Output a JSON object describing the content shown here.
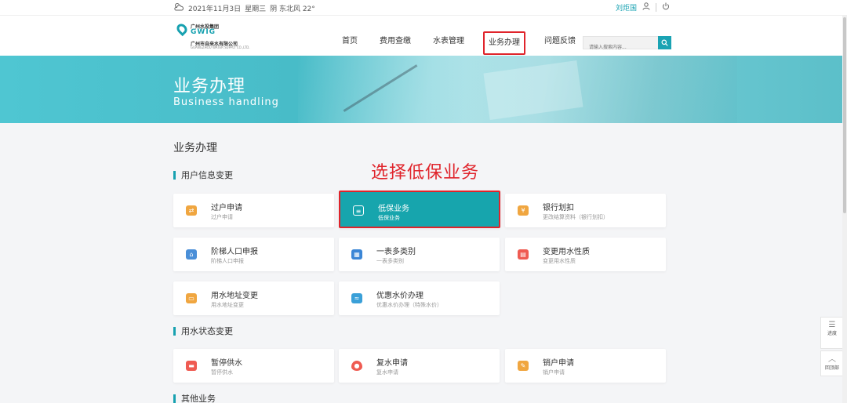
{
  "topbar": {
    "weather_icon": "cloud-sun-icon",
    "date": "2021年11月3日",
    "weekday": "星期三",
    "weather": "阴 东北风 22°",
    "username": "刘炬国",
    "user_icon": "user-icon",
    "power_icon": "power-icon"
  },
  "logo": {
    "line1": "广州水投集团",
    "line2": "GWIG",
    "line3": "广州市自来水有限公司",
    "line4": "GUANGZHOU WATER SUPPLY CO.,LTD."
  },
  "nav": {
    "items": [
      {
        "label": "首页"
      },
      {
        "label": "费用查缴"
      },
      {
        "label": "水表管理"
      },
      {
        "label": "业务办理"
      },
      {
        "label": "问题反馈"
      }
    ],
    "active_index": 3
  },
  "search": {
    "placeholder": "请输入搜索内容...",
    "button_icon": "search-icon"
  },
  "banner": {
    "title": "业务办理",
    "subtitle": "Business handling"
  },
  "main": {
    "title": "业务办理",
    "annotation": "选择低保业务",
    "sections": [
      {
        "title": "用户信息变更",
        "cards": [
          {
            "title": "过户申请",
            "sub": "过户申请",
            "icon": "transfer-icon",
            "color": "#f0a640"
          },
          {
            "title": "低保业务",
            "sub": "低保业务",
            "icon": "document-icon",
            "color": "#17a5ad",
            "highlighted": true
          },
          {
            "title": "银行划扣",
            "sub": "更改结算资料（银行划扣）",
            "icon": "bank-card-icon",
            "color": "#f0a640"
          },
          {
            "title": "阶梯人口申报",
            "sub": "阶梯人口申报",
            "icon": "home-people-icon",
            "color": "#4a8fd8"
          },
          {
            "title": "一表多类别",
            "sub": "一表多类别",
            "icon": "grid-icon",
            "color": "#3b86d6"
          },
          {
            "title": "变更用水性质",
            "sub": "变更用水性质",
            "icon": "water-type-icon",
            "color": "#ef5b52"
          },
          {
            "title": "用水地址变更",
            "sub": "用水地址变更",
            "icon": "address-card-icon",
            "color": "#f0a640"
          },
          {
            "title": "优惠水价办理",
            "sub": "优惠水价办理（特殊水价）",
            "icon": "discount-icon",
            "color": "#3aa0d8"
          }
        ]
      },
      {
        "title": "用水状态变更",
        "cards": [
          {
            "title": "暂停供水",
            "sub": "暂停供水",
            "icon": "pause-water-icon",
            "color": "#ef5b52"
          },
          {
            "title": "复水申请",
            "sub": "复水申请",
            "icon": "water-drop-icon",
            "color": "#ef5b52"
          },
          {
            "title": "销户申请",
            "sub": "销户申请",
            "icon": "close-account-icon",
            "color": "#f0a640"
          }
        ]
      },
      {
        "title": "其他业务",
        "cards": []
      }
    ]
  },
  "side": {
    "progress_label": "进度",
    "progress_icon": "sliders-icon",
    "top_label": "回顶部",
    "top_icon": "chevron-up-icon"
  }
}
